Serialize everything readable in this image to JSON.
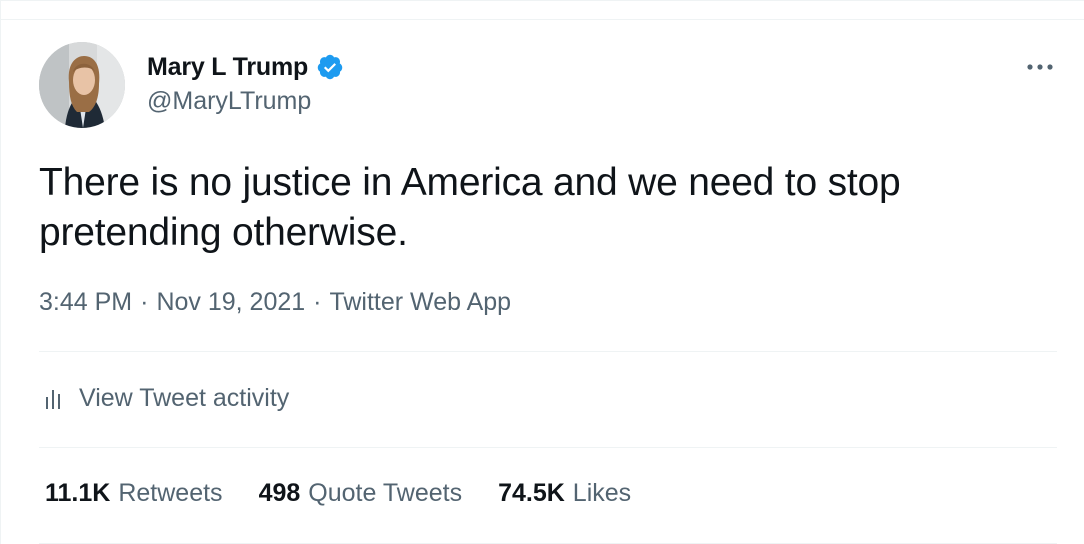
{
  "tweet": {
    "author": {
      "display_name": "Mary L Trump",
      "handle": "@MaryLTrump",
      "verified": true
    },
    "text": "There is no justice in America and we need to stop pretending otherwise.",
    "time": "3:44 PM",
    "date": "Nov 19, 2021",
    "source": "Twitter Web App",
    "separator": "·",
    "activity_label": "View Tweet activity",
    "stats": [
      {
        "count": "11.1K",
        "label": "Retweets"
      },
      {
        "count": "498",
        "label": "Quote Tweets"
      },
      {
        "count": "74.5K",
        "label": "Likes"
      }
    ]
  },
  "icons": {
    "verified": "verified-badge-icon",
    "more": "more-options-icon",
    "activity": "bar-chart-icon"
  },
  "colors": {
    "accent": "#1d9bf0",
    "text_primary": "#0f1419",
    "text_secondary": "#536471",
    "divider": "#eff3f4"
  }
}
